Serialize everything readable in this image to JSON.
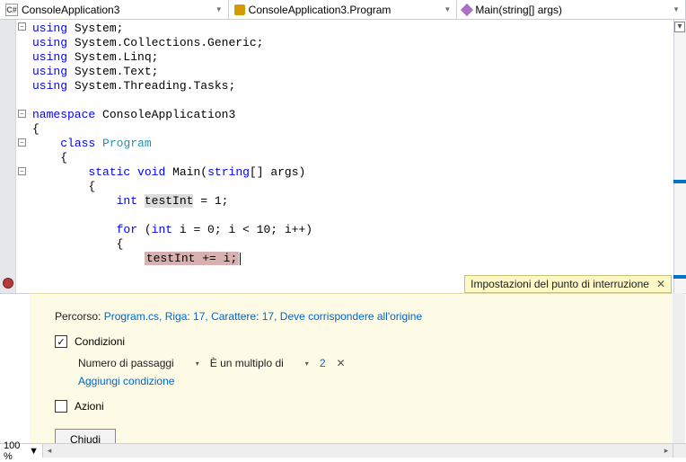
{
  "topbar": {
    "project": "ConsoleApplication3",
    "class": "ConsoleApplication3.Program",
    "method": "Main(string[] args)"
  },
  "code": {
    "kw_using": "using",
    "ns_system": "System",
    "ns_generic": "System.Collections.Generic",
    "ns_linq": "System.Linq",
    "ns_text": "System.Text",
    "ns_tasks": "System.Threading.Tasks",
    "kw_namespace": "namespace",
    "nsname": "ConsoleApplication3",
    "kw_class": "class",
    "classname": "Program",
    "kw_static": "static",
    "kw_void": "void",
    "method": "Main",
    "kw_string": "string",
    "params": "[] args)",
    "kw_int": "int",
    "varname": "testInt",
    "init": " = 1;",
    "kw_for": "for",
    "forline": " i = 0; i < 10; i++)",
    "bp_line": "testInt += i;"
  },
  "popup": {
    "title": "Impostazioni del punto di interruzione",
    "location_label": "Percorso: ",
    "location": "Program.cs, Riga: 17, Carattere: 17, Deve corrispondere all'origine",
    "conditions": "Condizioni",
    "hitcount": "Numero di passaggi",
    "multipleof": "È un multiplo di",
    "value": "2",
    "addcond": "Aggiungi condizione",
    "actions": "Azioni",
    "close": "Chiudi"
  },
  "status": {
    "zoom": "100 %"
  }
}
